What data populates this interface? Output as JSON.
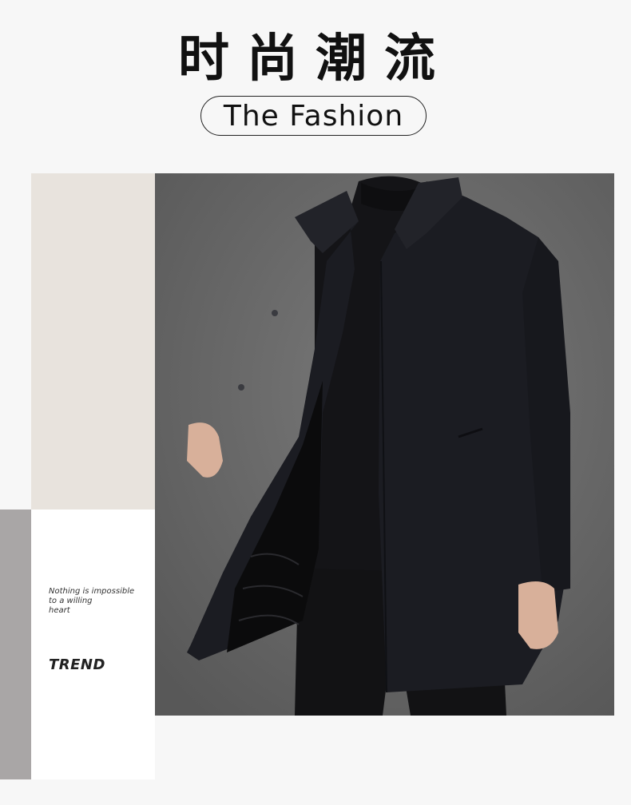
{
  "header": {
    "title_cn": "时尚潮流",
    "subtitle": "The Fashion"
  },
  "side_panel": {
    "tagline_lines": [
      "Nothing is impossible",
      "to a willing",
      "heart"
    ],
    "trend_label": "TREND"
  },
  "photo": {
    "subject": "man wearing dark wool overcoat",
    "background_color": "#6a6a6a",
    "coat_color": "#1b1c22"
  },
  "colors": {
    "page_background": "#f7f7f7",
    "beige_block": "#e8e3dd",
    "gray_bar": "#a9a6a6"
  }
}
